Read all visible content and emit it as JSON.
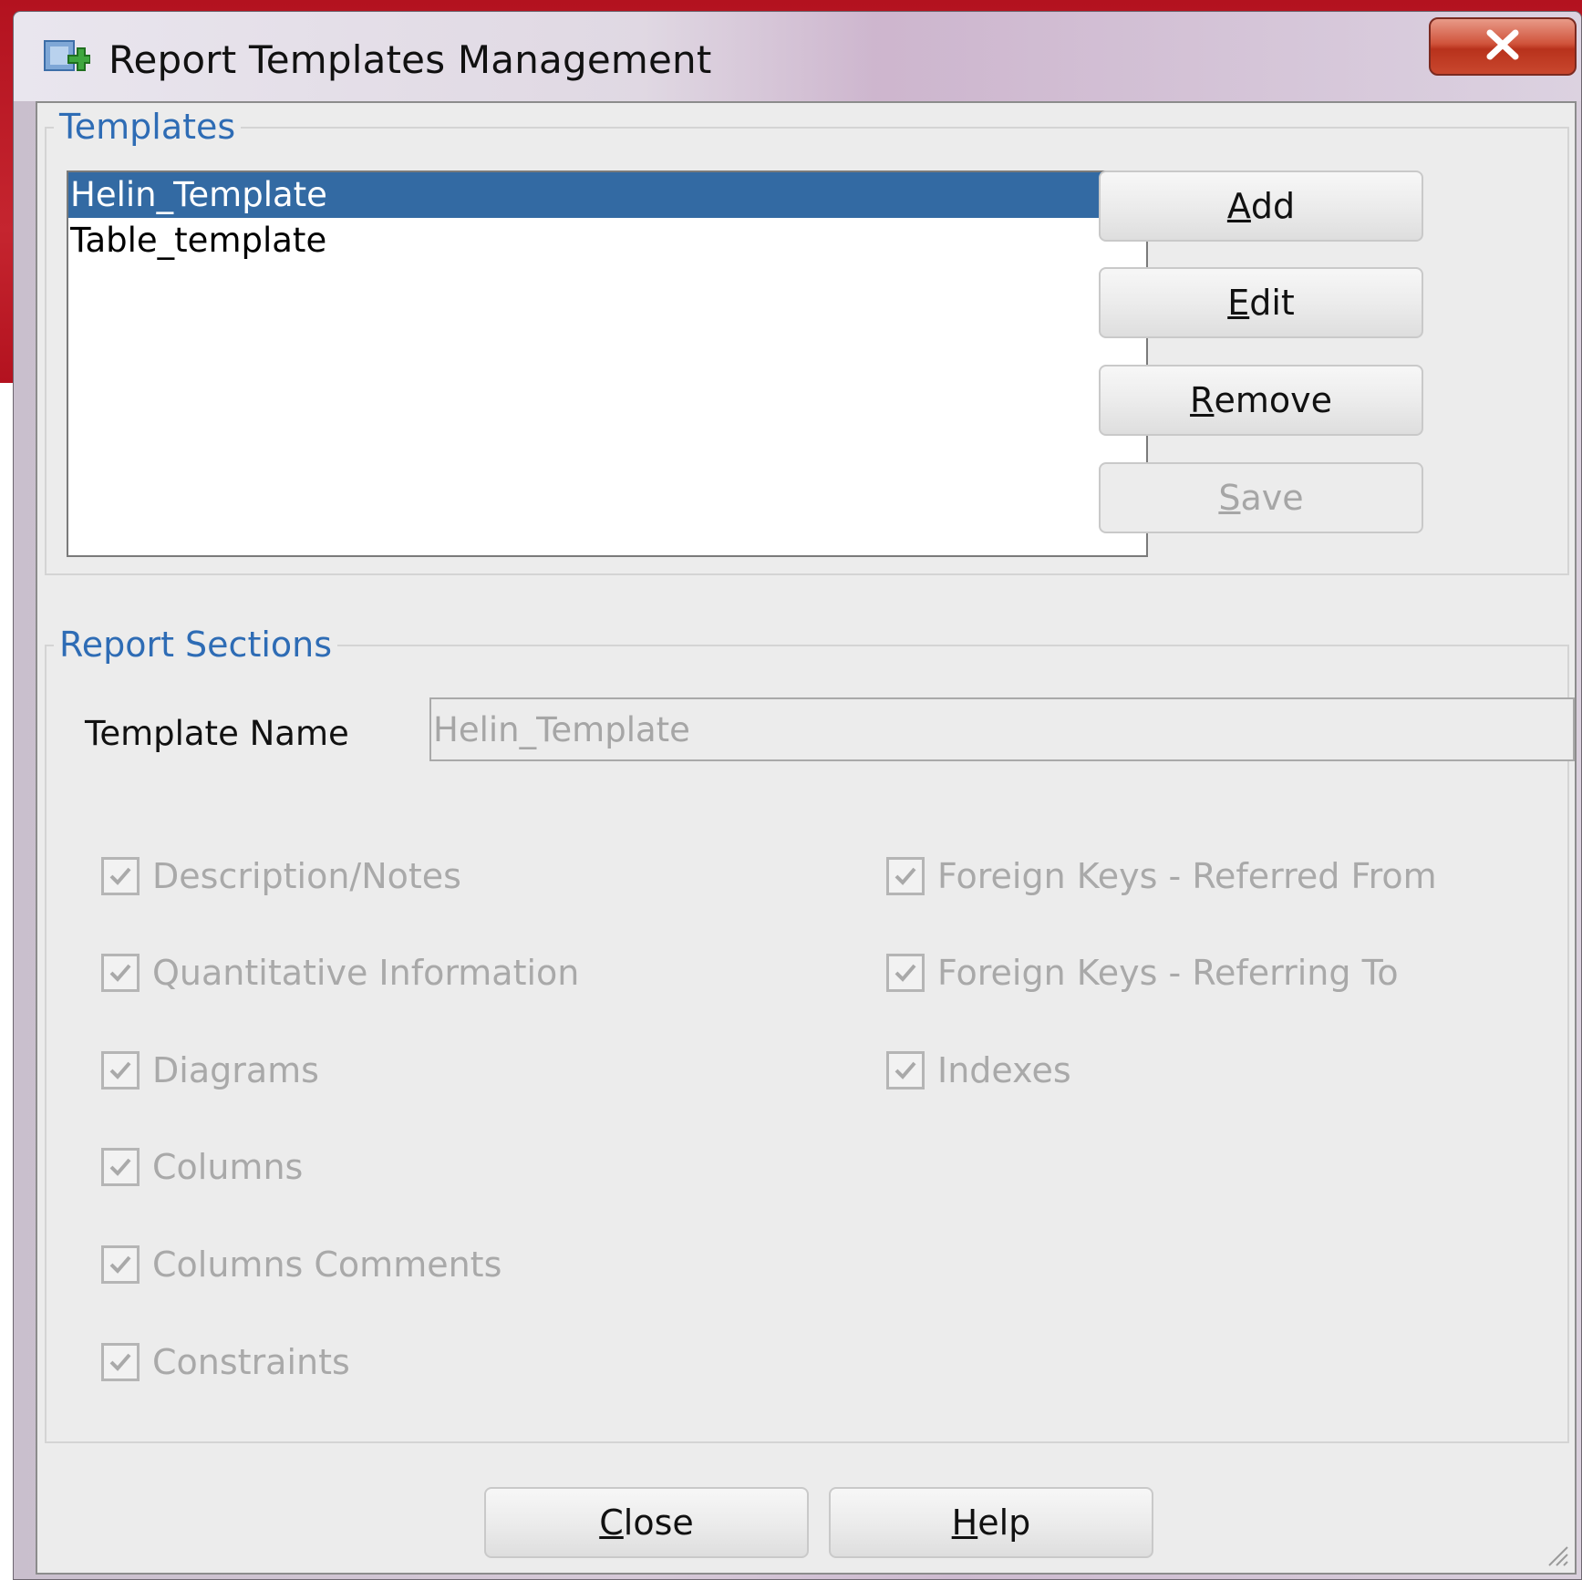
{
  "window": {
    "title": "Report Templates Management",
    "close_icon": "close-x-icon"
  },
  "templates": {
    "group_title": "Templates",
    "items": [
      {
        "label": "Helin_Template",
        "selected": true
      },
      {
        "label": "Table_template",
        "selected": false
      }
    ],
    "buttons": {
      "add": {
        "pre": "",
        "mnemonic": "A",
        "post": "dd",
        "enabled": true
      },
      "edit": {
        "pre": "",
        "mnemonic": "E",
        "post": "dit",
        "enabled": true
      },
      "remove": {
        "pre": "",
        "mnemonic": "R",
        "post": "emove",
        "enabled": true
      },
      "save": {
        "pre": "",
        "mnemonic": "S",
        "post": "ave",
        "enabled": false
      }
    }
  },
  "report_sections": {
    "group_title": "Report Sections",
    "template_name_label": "Template Name",
    "template_name_value": "Helin_Template",
    "left_checkboxes": [
      {
        "label": "Description/Notes",
        "checked": true
      },
      {
        "label": "Quantitative Information",
        "checked": true
      },
      {
        "label": "Diagrams",
        "checked": true
      },
      {
        "label": "Columns",
        "checked": true
      },
      {
        "label": "Columns Comments",
        "checked": true
      },
      {
        "label": "Constraints",
        "checked": true
      }
    ],
    "right_checkboxes": [
      {
        "label": "Foreign Keys - Referred From",
        "checked": true
      },
      {
        "label": "Foreign Keys - Referring To",
        "checked": true
      },
      {
        "label": "Indexes",
        "checked": true
      }
    ]
  },
  "footer": {
    "close": {
      "pre": "",
      "mnemonic": "C",
      "post": "lose"
    },
    "help": {
      "pre": "",
      "mnemonic": "H",
      "post": "elp"
    }
  },
  "colors": {
    "selection": "#336aa3",
    "group_title": "#2e6cb5",
    "disabled_text": "#a9a9a9",
    "background": "#ececec"
  }
}
